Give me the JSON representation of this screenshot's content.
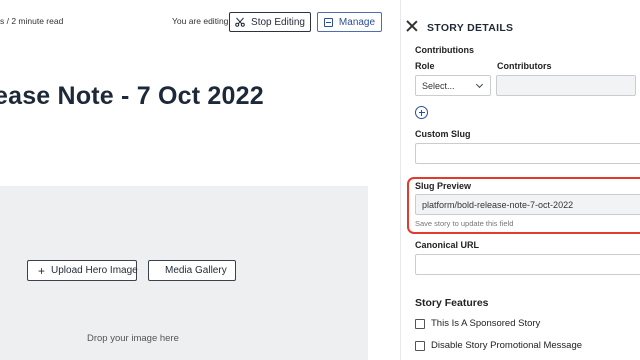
{
  "editor": {
    "meta_text": "s / 2 minute read",
    "editing_text": "You are editing",
    "stop_editing_label": "Stop Editing",
    "manage_label": "Manage",
    "title": "ease Note - 7 Oct 2022",
    "hero": {
      "upload_label": "Upload Hero Image",
      "gallery_label": "Media Gallery",
      "drop_text": "Drop your image here"
    }
  },
  "panel": {
    "title": "STORY DETAILS",
    "contributions": {
      "heading": "Contributions",
      "role_label": "Role",
      "role_value": "Select...",
      "contributors_label": "Contributors",
      "contributors_value": ""
    },
    "custom_slug": {
      "label": "Custom Slug",
      "value": ""
    },
    "slug_preview": {
      "label": "Slug Preview",
      "value": "platform/bold-release-note-7-oct-2022",
      "help": "Save story to update this field"
    },
    "canonical_url": {
      "label": "Canonical URL",
      "value": ""
    },
    "story_features": {
      "heading": "Story Features",
      "options": [
        {
          "label": "This Is A Sponsored Story",
          "checked": false
        },
        {
          "label": "Disable Story Promotional Message",
          "checked": false
        }
      ]
    }
  },
  "colors": {
    "accent": "#2c4f9a",
    "highlight": "#e23b2e",
    "hero_bg": "#eeeff1"
  }
}
